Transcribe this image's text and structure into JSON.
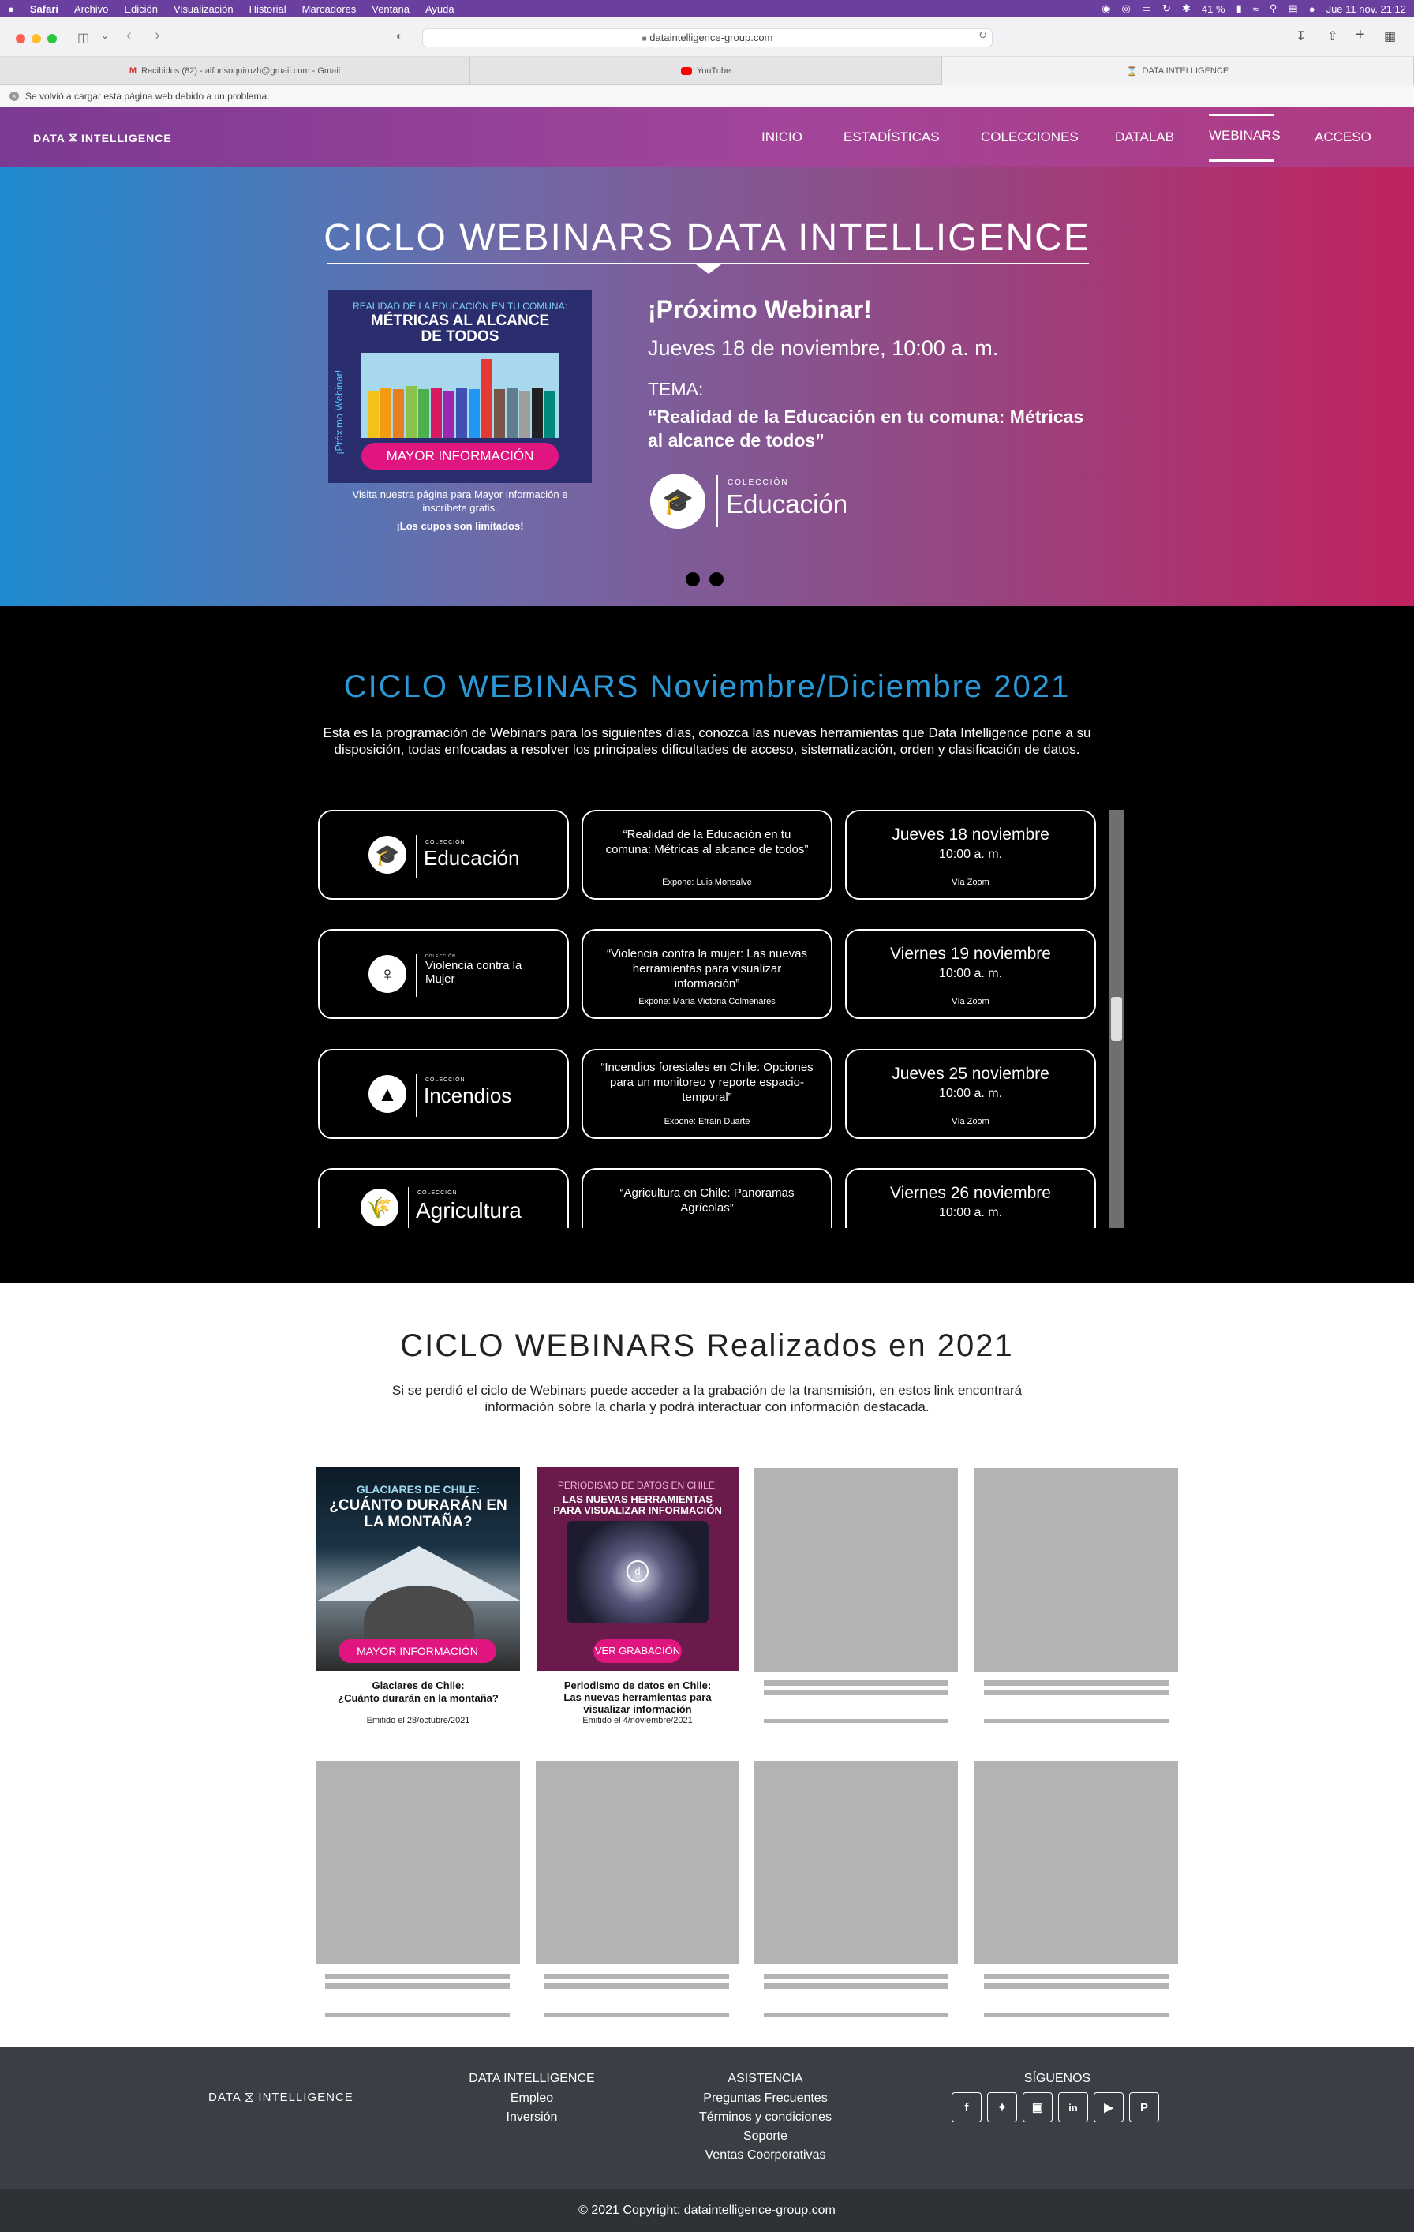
{
  "os_menu": {
    "apple": "",
    "app": "Safari",
    "items": [
      "Archivo",
      "Edición",
      "Visualización",
      "Historial",
      "Marcadores",
      "Ventana",
      "Ayuda"
    ],
    "battery": "41 %",
    "clock": "Jue 11 nov.  21:12"
  },
  "browser": {
    "url": "dataintelligence-group.com",
    "tabs": [
      {
        "label": "Recibidos (82) - alfonsoquirozh@gmail.com - Gmail"
      },
      {
        "label": "YouTube"
      },
      {
        "label": "DATA INTELLIGENCE"
      }
    ],
    "reload_notice": "Se volvió a cargar esta página web debido a un problema."
  },
  "site": {
    "logo_left": "DATA",
    "logo_right": "INTELLIGENCE",
    "nav": [
      "INICIO",
      "ESTADÍSTICAS",
      "COLECCIONES",
      "DATALAB",
      "WEBINARS",
      "ACCESO"
    ],
    "nav_active": "WEBINARS"
  },
  "hero": {
    "title": "CICLO WEBINARS DATA INTELLIGENCE",
    "poster_kicker": "REALIDAD DE LA EDUCACIÓN EN TU COMUNA:",
    "poster_title_1": "MÉTRICAS AL ALCANCE",
    "poster_title_2": "DE TODOS",
    "poster_side": "¡Próximo Webinar!",
    "poster_button": "MAYOR INFORMACIÓN",
    "visit_1": "Visita nuestra página para Mayor Información e",
    "visit_2": "inscríbete gratis.",
    "visit_3": "¡Los cupos son limitados!",
    "next_label": "¡Próximo Webinar!",
    "next_date": "Jueves 18 de noviembre, 10:00 a. m.",
    "tema_label": "TEMA:",
    "tema_1": "“Realidad de la Educación en tu comuna: Métricas",
    "tema_2": "al alcance de todos”",
    "collection_small": "COLECCIÓN",
    "collection_name": "Educación"
  },
  "upcoming": {
    "title": "CICLO WEBINARS Noviembre/Diciembre 2021",
    "intro_1": "Esta es la programación de Webinars para los siguientes días, conozca las nuevas herramientas que Data Intelligence pone a su",
    "intro_2": "disposición, todas enfocadas a resolver los principales dificultades de acceso, sistematización, orden y clasificación de datos.",
    "rows": [
      {
        "collection_small": "COLECCIÓN",
        "collection": "Educación",
        "icon": "graduation-cap-icon",
        "topic": "“Realidad de la Educación en tu comuna: Métricas al alcance de todos”",
        "speaker": "Expone: Luis Monsalve",
        "date": "Jueves 18 noviembre",
        "time": "10:00 a. m.",
        "via": "Vía Zoom"
      },
      {
        "collection_small": "COLECCIÓN",
        "collection": "Violencia contra la Mujer",
        "icon": "female-symbol-icon",
        "topic": "“Violencia contra la mujer: Las nuevas herramientas para visualizar información”",
        "speaker": "Expone: María Victoria Colmenares",
        "date": "Viernes 19 noviembre",
        "time": "10:00 a. m.",
        "via": "Vía Zoom"
      },
      {
        "collection_small": "COLECCIÓN",
        "collection": "Incendios",
        "icon": "fire-icon",
        "topic": "“Incendios forestales en Chile: Opciones para un monitoreo y reporte espacio-temporal”",
        "speaker": "Expone: Efraín Duarte",
        "date": "Jueves 25 noviembre",
        "time": "10:00 a. m.",
        "via": "Vía Zoom"
      },
      {
        "collection_small": "COLECCIÓN",
        "collection": "Agricultura",
        "icon": "wheat-icon",
        "topic": "“Agricultura en Chile: Panoramas Agrícolas”",
        "speaker": "",
        "date": "Viernes 26 noviembre",
        "time": "10:00 a. m.",
        "via": ""
      }
    ]
  },
  "past": {
    "title": "CICLO WEBINARS Realizados en 2021",
    "intro_1": "Si se perdió el ciclo de Webinars puede acceder a la grabación de la transmisión, en estos link encontrará",
    "intro_2": "información sobre la charla y podrá interactuar con información destacada.",
    "items": [
      {
        "poster_kicker": "GLACIARES DE CHILE:",
        "poster_title_1": "¿CUÁNTO DURARÁN EN",
        "poster_title_2": "LA MONTAÑA?",
        "button": "MAYOR INFORMACIÓN",
        "title_1": "Glaciares de Chile:",
        "title_2": "¿Cuánto durarán en la montaña?",
        "emitted": "Emitido el 28/octubre/2021"
      },
      {
        "poster_kicker": "PERIODISMO DE DATOS EN CHILE:",
        "poster_title_1": "LAS NUEVAS HERRAMIENTAS",
        "poster_title_2": "PARA VISUALIZAR INFORMACIÓN",
        "button": "VER GRABACIÓN",
        "title_1": "Periodismo de datos en Chile:",
        "title_2": "Las nuevas herramientas para",
        "title_3": "visualizar información",
        "emitted": "Emitido el 4/noviembre/2021"
      }
    ]
  },
  "footer": {
    "col1_title": "DATA INTELLIGENCE",
    "col1_links": [
      "Empleo",
      "Inversión"
    ],
    "col2_title": "ASISTENCIA",
    "col2_links": [
      "Preguntas Frecuentes",
      "Términos y condiciones",
      "Soporte",
      "Ventas Coorporativas"
    ],
    "col3_title": "SÍGUENOS",
    "social": [
      "facebook-icon",
      "twitter-icon",
      "instagram-icon",
      "linkedin-icon",
      "youtube-icon",
      "pinterest-icon"
    ],
    "copyright": "© 2021 Copyright: dataintelligence-group.com"
  },
  "colors": {
    "accent_pink": "#e0157f",
    "title_blue": "#2a98d6",
    "poster_navy": "#2b2e6e",
    "footer": "#3b3e45"
  }
}
